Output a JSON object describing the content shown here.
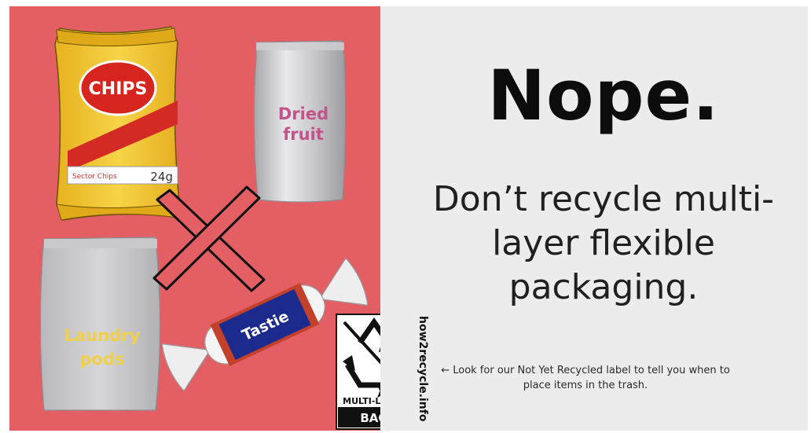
{
  "headline": "Nope.",
  "subhead": "Don’t recycle multi-layer flexible packaging.",
  "note": "← Look for our Not Yet Recycled label to tell you when to place items in the trash.",
  "items": {
    "chips_brand": "CHIPS",
    "chips_subtext": "Sector Chips",
    "chips_weight": "24g",
    "dried_fruit_line1": "Dried",
    "dried_fruit_line2": "fruit",
    "laundry_line1": "Laundry",
    "laundry_line2": "pods",
    "candy_brand": "Tastie"
  },
  "label": {
    "material": "MULTI-LAYER",
    "type": "BAG",
    "website": "how2recycle.info"
  },
  "colors": {
    "left_background": "#e35f64",
    "right_background": "#ececec",
    "chips_yellow": "#f2c62a",
    "dried_fruit_text": "#c2548a",
    "laundry_text": "#f0d04a",
    "candy_blue": "#1b2a8c"
  }
}
